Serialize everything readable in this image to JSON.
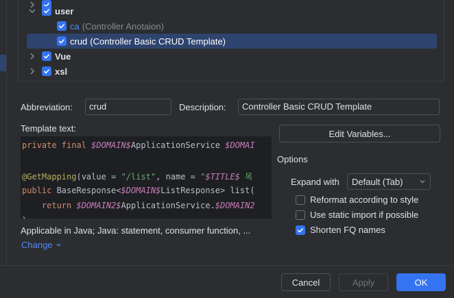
{
  "tree": {
    "groups": [
      {
        "label": "user",
        "checked": true,
        "expanded": true
      },
      {
        "label": "Vue",
        "checked": true,
        "expanded": false
      },
      {
        "label": "xsl",
        "checked": true,
        "expanded": false
      }
    ],
    "templates": [
      {
        "abbr": "ca",
        "desc": "(Controller Anotaion)",
        "checked": true
      },
      {
        "abbr": "crud",
        "desc": "(Controller Basic CRUD Template)",
        "checked": true,
        "selected": true
      }
    ]
  },
  "form": {
    "abbreviation_label": "Abbreviation:",
    "abbreviation_value": "crud",
    "description_label": "Description:",
    "description_value": "Controller Basic CRUD Template",
    "template_text_label": "Template text:",
    "edit_variables_label": "Edit Variables...",
    "applicable_text": "Applicable in Java; Java: statement, consumer function, ...",
    "change_label": "Change"
  },
  "editor": {
    "lines": [
      {
        "parts": [
          {
            "t": "private final ",
            "c": "kw"
          },
          {
            "t": "$DOMAIN$",
            "c": "var"
          },
          {
            "t": "ApplicationService ",
            "c": ""
          },
          {
            "t": "$DOMAI",
            "c": "var"
          }
        ]
      },
      {
        "parts": []
      },
      {
        "parts": [
          {
            "t": "@GetMapping",
            "c": "ann"
          },
          {
            "t": "(value = ",
            "c": ""
          },
          {
            "t": "\"/list\"",
            "c": "str"
          },
          {
            "t": ", name = ",
            "c": ""
          },
          {
            "t": "\"",
            "c": "str"
          },
          {
            "t": "$TITLE$",
            "c": "var"
          },
          {
            "t": " 목",
            "c": "str"
          }
        ]
      },
      {
        "parts": [
          {
            "t": "public ",
            "c": "kw"
          },
          {
            "t": "BaseResponse<",
            "c": ""
          },
          {
            "t": "$DOMAIN$",
            "c": "var"
          },
          {
            "t": "ListResponse> list(",
            "c": ""
          }
        ]
      },
      {
        "parts": [
          {
            "t": "    return ",
            "c": "kw"
          },
          {
            "t": "$DOMAIN2$",
            "c": "var"
          },
          {
            "t": "ApplicationService.",
            "c": ""
          },
          {
            "t": "$DOMAIN2",
            "c": "var"
          }
        ]
      },
      {
        "parts": [
          {
            "t": "}",
            "c": ""
          }
        ]
      }
    ]
  },
  "options": {
    "title": "Options",
    "expand_with_label": "Expand with",
    "expand_with_value": "Default (Tab)",
    "checkboxes": [
      {
        "label": "Reformat according to style",
        "checked": false
      },
      {
        "label": "Use static import if possible",
        "checked": false
      },
      {
        "label": "Shorten FQ names",
        "checked": true
      }
    ]
  },
  "footer": {
    "cancel_label": "Cancel",
    "apply_label": "Apply",
    "ok_label": "OK"
  },
  "colors": {
    "background": "#2b2d30",
    "accent": "#3574f0",
    "selection": "#2e436e",
    "link": "#548af7"
  }
}
